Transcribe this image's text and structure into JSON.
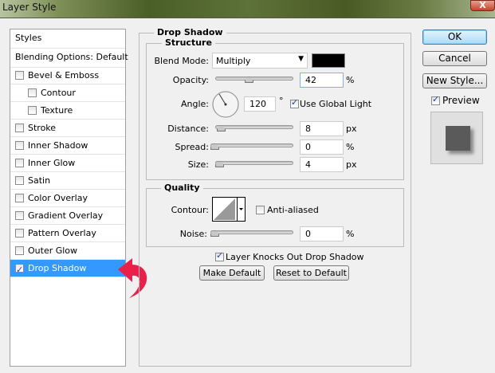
{
  "window": {
    "title": "Layer Style",
    "close_label": "X"
  },
  "sidebar": {
    "items": [
      {
        "label": "Styles",
        "checkbox": false
      },
      {
        "label": "Blending Options: Default",
        "checkbox": false
      },
      {
        "label": "Bevel & Emboss",
        "checkbox": true,
        "checked": false
      },
      {
        "label": "Contour",
        "checkbox": true,
        "checked": false,
        "indent": true
      },
      {
        "label": "Texture",
        "checkbox": true,
        "checked": false,
        "indent": true
      },
      {
        "label": "Stroke",
        "checkbox": true,
        "checked": false
      },
      {
        "label": "Inner Shadow",
        "checkbox": true,
        "checked": false
      },
      {
        "label": "Inner Glow",
        "checkbox": true,
        "checked": false
      },
      {
        "label": "Satin",
        "checkbox": true,
        "checked": false
      },
      {
        "label": "Color Overlay",
        "checkbox": true,
        "checked": false
      },
      {
        "label": "Gradient Overlay",
        "checkbox": true,
        "checked": false
      },
      {
        "label": "Pattern Overlay",
        "checkbox": true,
        "checked": false
      },
      {
        "label": "Outer Glow",
        "checkbox": true,
        "checked": false
      },
      {
        "label": "Drop Shadow",
        "checkbox": true,
        "checked": true,
        "selected": true
      }
    ]
  },
  "panel": {
    "title": "Drop Shadow",
    "structure": {
      "title": "Structure",
      "blend_mode_label": "Blend Mode:",
      "blend_mode": "Multiply",
      "shadow_color": "#000000",
      "opacity_label": "Opacity:",
      "opacity": "42",
      "opacity_unit": "%",
      "angle_label": "Angle:",
      "angle": "120",
      "angle_unit": "°",
      "global_light_label": "Use Global Light",
      "distance_label": "Distance:",
      "distance": "8",
      "distance_unit": "px",
      "spread_label": "Spread:",
      "spread": "0",
      "spread_unit": "%",
      "size_label": "Size:",
      "size": "4",
      "size_unit": "px"
    },
    "quality": {
      "title": "Quality",
      "contour_label": "Contour:",
      "anti_aliased_label": "Anti-aliased",
      "noise_label": "Noise:",
      "noise": "0",
      "noise_unit": "%"
    },
    "knockout_label": "Layer Knocks Out Drop Shadow",
    "make_default": "Make Default",
    "reset_default": "Reset to Default"
  },
  "buttons": {
    "ok": "OK",
    "cancel": "Cancel",
    "new_style": "New Style...",
    "preview_label": "Preview"
  },
  "colors": {
    "selection": "#3399ff",
    "arrow": "#e8204a"
  }
}
